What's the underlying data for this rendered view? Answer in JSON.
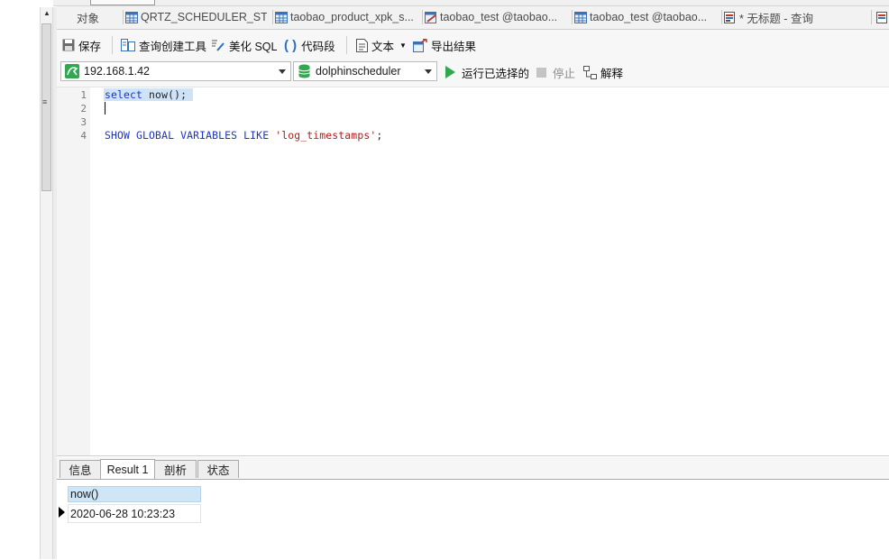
{
  "tabs": [
    {
      "label": "对象",
      "icon": "none"
    },
    {
      "label": "QRTZ_SCHEDULER_ST...",
      "icon": "table-grid-icon"
    },
    {
      "label": "taobao_product_xpk_s...",
      "icon": "table-grid-icon"
    },
    {
      "label": "taobao_test @taobao...",
      "icon": "table-design-icon"
    },
    {
      "label": "taobao_test @taobao...",
      "icon": "table-grid-icon"
    },
    {
      "label": "* 无标题 - 查询",
      "icon": "query-icon"
    }
  ],
  "toolbar1": {
    "save": "保存",
    "query_builder": "查询创建工具",
    "beautify": "美化 SQL",
    "snippet": "代码段",
    "text": "文本",
    "export": "导出结果"
  },
  "toolbar2": {
    "connection": "192.168.1.42",
    "database": "dolphinscheduler",
    "run": "运行已选择的",
    "stop": "停止",
    "explain": "解释"
  },
  "editor": {
    "lines": [
      {
        "num": "1",
        "tokens": [
          {
            "t": "select",
            "k": "kw"
          },
          {
            "t": " now();",
            "k": "plain"
          }
        ]
      },
      {
        "num": "2",
        "tokens": []
      },
      {
        "num": "3",
        "tokens": []
      },
      {
        "num": "4",
        "tokens": [
          {
            "t": "SHOW GLOBAL VARIABLES LIKE ",
            "k": "kw"
          },
          {
            "t": "'log_timestamps'",
            "k": "str"
          },
          {
            "t": ";",
            "k": "plain"
          }
        ]
      }
    ]
  },
  "result_tabs": [
    "信息",
    "Result 1",
    "剖析",
    "状态"
  ],
  "result": {
    "columns": [
      "now()"
    ],
    "rows": [
      [
        "2020-06-28 10:23:23"
      ]
    ]
  },
  "colors": {
    "keyword": "#1c34c8",
    "string": "#b31b1b",
    "selection": "#cfe3f7",
    "header": "#cfe6f7"
  }
}
